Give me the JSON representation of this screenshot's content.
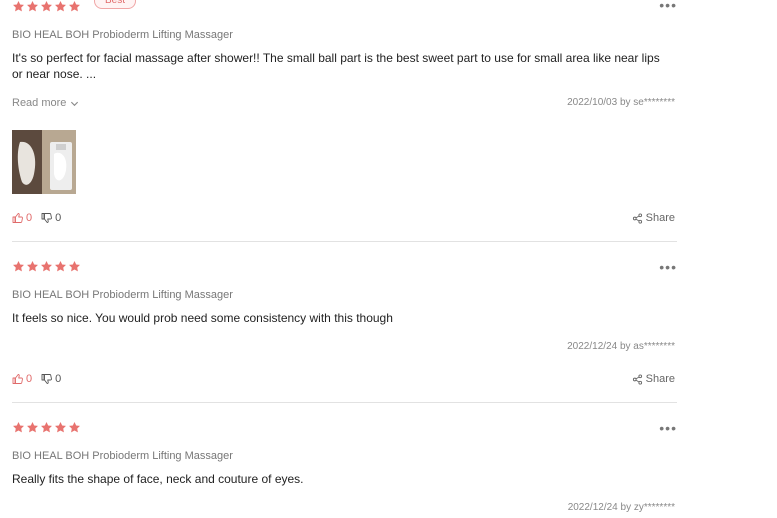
{
  "colors": {
    "star": "#e8736f",
    "like": "#e06a6a",
    "divider": "#e2e2e2"
  },
  "reviews": [
    {
      "rating": 5,
      "badge": "Best",
      "product": "BIO HEAL BOH Probioderm Lifting Massager",
      "text": "It's so perfect for facial massage after shower!! The small ball part is the best sweet part to use for small area like near lips or near nose. ...",
      "read_more": "Read more",
      "meta": "2022/10/03 by se********",
      "has_photo": true,
      "likes": "0",
      "dislikes": "0",
      "share": "Share",
      "more_icon": "more-dots-icon"
    },
    {
      "rating": 5,
      "product": "BIO HEAL BOH Probioderm Lifting Massager",
      "text": "It feels so nice. You would prob need some consistency with this though",
      "meta": "2022/12/24 by as********",
      "likes": "0",
      "dislikes": "0",
      "share": "Share",
      "more_icon": "more-dots-icon"
    },
    {
      "rating": 5,
      "product": "BIO HEAL BOH Probioderm Lifting Massager",
      "text": "Really fits the shape of face, neck and couture of eyes.",
      "meta": "2022/12/24 by zy********",
      "more_icon": "more-dots-icon"
    }
  ]
}
